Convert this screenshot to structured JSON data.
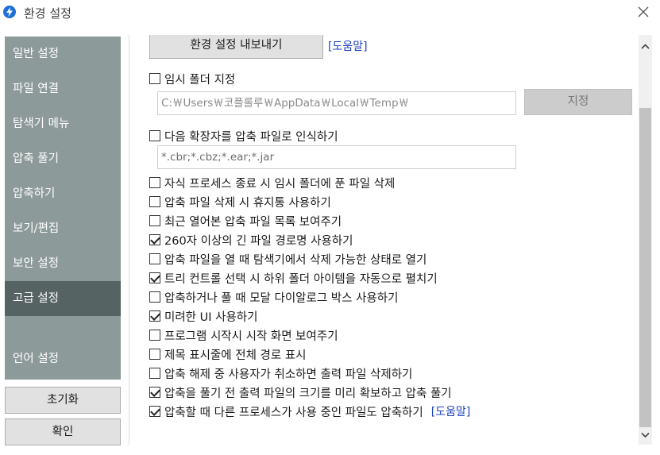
{
  "window": {
    "title": "환경 설정"
  },
  "sidebar": {
    "items": [
      {
        "label": "일반 설정"
      },
      {
        "label": "파일 연결"
      },
      {
        "label": "탐색기 메뉴"
      },
      {
        "label": "압축 풀기"
      },
      {
        "label": "압축하기"
      },
      {
        "label": "보기/편집"
      },
      {
        "label": "보안 설정"
      },
      {
        "label": "고급 설정",
        "active": true
      },
      {
        "label": "언어 설정"
      }
    ],
    "reset_label": "초기화",
    "ok_label": "확인"
  },
  "content": {
    "export_label": "환경 설정 내보내기",
    "help_link": "[도움말]",
    "temp_folder": {
      "label": "임시 폴더 지정",
      "checked": false,
      "path_value": "C:￦Users￦코플롤루￦AppData￦Local￦Temp￦",
      "set_label": "지정"
    },
    "extensions": {
      "label": "다음 확장자를 압축 파일로 인식하기",
      "checked": false,
      "value": "*.cbr;*.cbz;*.ear;*.jar"
    },
    "options": [
      {
        "label": "자식 프로세스 종료 시 임시 폴더에 푼 파일 삭제",
        "checked": false
      },
      {
        "label": "압축 파일 삭제 시 휴지통 사용하기",
        "checked": false
      },
      {
        "label": "최근 열어본 압축 파일 목록 보여주기",
        "checked": false
      },
      {
        "label": "260자 이상의 긴 파일 경로명 사용하기",
        "checked": true
      },
      {
        "label": "압축 파일을 열 때 탐색기에서 삭제 가능한 상태로 열기",
        "checked": false
      },
      {
        "label": "트리 컨트롤 선택 시 하위 폴더 아이템을 자동으로 펼치기",
        "checked": true
      },
      {
        "label": "압축하거나 풀 때 모달 다이알로그 박스 사용하기",
        "checked": false
      },
      {
        "label": "미려한 UI 사용하기",
        "checked": true
      },
      {
        "label": "프로그램 시작시 시작 화면 보여주기",
        "checked": false
      },
      {
        "label": "제목 표시줄에 전체 경로 표시",
        "checked": false
      },
      {
        "label": "압축 해제 중 사용자가 취소하면 출력 파일 삭제하기",
        "checked": false
      },
      {
        "label": "압축을 풀기 전 출력 파일의 크기를 미리 확보하고 압축 풀기",
        "checked": true
      },
      {
        "label": "압축할 때 다른 프로세스가 사용 중인 파일도 압축하기",
        "checked": true,
        "help": "[도움말]"
      }
    ]
  },
  "colors": {
    "sidebar_bg": "#8d9a9a",
    "sidebar_active": "#566363",
    "link": "#1a3fc2"
  }
}
